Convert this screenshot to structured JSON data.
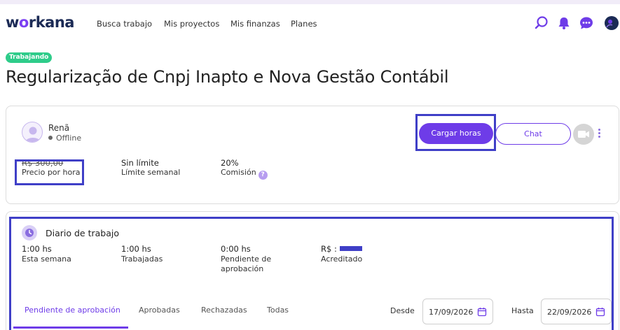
{
  "header": {
    "logo": {
      "pre": "w",
      "o": "o",
      "post": "rkana"
    },
    "nav": [
      "Busca trabajo",
      "Mis proyectos",
      "Mis finanzas",
      "Planes"
    ],
    "icons": [
      "search-icon",
      "bell-icon",
      "chat-bubble-icon",
      "avatar"
    ]
  },
  "project": {
    "status": "Trabajando",
    "title": "Regularização de Cnpj Inapto e Nova Gestão Contábil"
  },
  "client": {
    "name": "Renã",
    "status": "Offline",
    "stats": [
      {
        "value": "R$ 300,00",
        "label": "Precio por hora"
      },
      {
        "value": "Sin límite",
        "label": "Límite semanal"
      },
      {
        "value": "20%",
        "label": "Comisión",
        "help": "?"
      }
    ],
    "buttons": {
      "primary": "Cargar horas",
      "secondary": "Chat"
    }
  },
  "diary": {
    "title": "Diario de trabajo",
    "stats": [
      {
        "value": "1:00 hs",
        "label": "Esta semana"
      },
      {
        "value": "1:00 hs",
        "label": "Trabajadas"
      },
      {
        "value": "0:00 hs",
        "label": "Pendiente de aprobación"
      },
      {
        "value": "R$ :",
        "label": "Acreditado"
      }
    ],
    "tabs": [
      "Pendiente de aprobación",
      "Aprobadas",
      "Rechazadas",
      "Todas"
    ],
    "active_tab": "Pendiente de aprobación",
    "filters": {
      "from_label": "Desde",
      "from_value": "17/09/2026",
      "to_label": "Hasta",
      "to_value": "22/09/2026"
    }
  },
  "colors": {
    "accent": "#6e3ce8",
    "status_badge": "#2ecc8a",
    "highlight": "#3f3fc7"
  }
}
